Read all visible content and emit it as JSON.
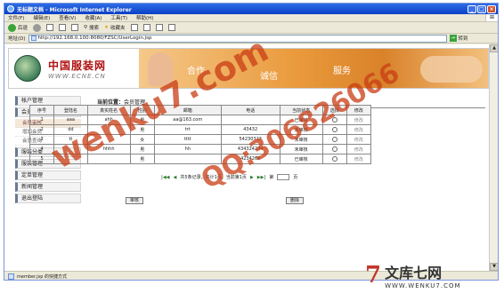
{
  "window": {
    "title": "无标题文档 - Microsoft Internet Explorer",
    "buttons": [
      "_",
      "□",
      "×"
    ]
  },
  "menu": {
    "items": [
      "文件(F)",
      "编辑(E)",
      "查看(V)",
      "收藏(A)",
      "工具(T)",
      "帮助(H)"
    ]
  },
  "toolbar": {
    "back": "后退",
    "search": "搜索",
    "favorites": "收藏夹"
  },
  "address": {
    "label": "地址(D)",
    "url": "http://192.168.0.100:8080/FZSC/UserLogin.jsp",
    "go": "转到"
  },
  "site": {
    "title_cn": "中国服装网",
    "title_en": "WWW.ECNE.CN",
    "banner_words": [
      "合作",
      "诚信",
      "服务"
    ]
  },
  "sidebar": {
    "items": [
      "帐户管理",
      "会员管理",
      "服装分类",
      "服装管理",
      "定单管理",
      "新闻管理",
      "退出登陆"
    ],
    "sub_items": [
      "会员审核",
      "增加会员",
      "会员查询"
    ]
  },
  "location": {
    "label": "当前位置：",
    "value": "会员管理"
  },
  "table": {
    "headers": [
      "序号",
      "登陆名",
      "真实姓名",
      "性别",
      "邮箱",
      "电话",
      "当前状态",
      "选择",
      "修改"
    ],
    "rows": [
      [
        "1",
        "aaa",
        "ahh",
        "男",
        "aa@163.com",
        "",
        "已审核",
        "",
        "修改"
      ],
      [
        "2",
        "dd",
        "",
        "男",
        "trt",
        "43432",
        "未审核",
        "",
        "修改"
      ],
      [
        "3",
        "tt",
        "",
        "女",
        "tttt",
        "54230323",
        "未审核",
        "",
        "修改"
      ],
      [
        "4",
        "",
        "hhhh",
        "男",
        "hh",
        "434324234",
        "未审核",
        "",
        "修改"
      ],
      [
        "5",
        "",
        "",
        "男",
        "",
        "4234266",
        "已审核",
        "",
        "修改"
      ]
    ]
  },
  "pager": {
    "info": "共5条记录，共计1页，当前第1页",
    "page_label": "第",
    "page_suffix": "页"
  },
  "actions": {
    "approve": "审核",
    "delete": "删除"
  },
  "status": {
    "text": "member.jsp 的快捷方式"
  },
  "watermarks": [
    "wenku7.com",
    "QQ:306826066"
  ],
  "brand": {
    "mark": "7",
    "cn": "文库七网",
    "en": "WWW.WENKU7.COM"
  }
}
